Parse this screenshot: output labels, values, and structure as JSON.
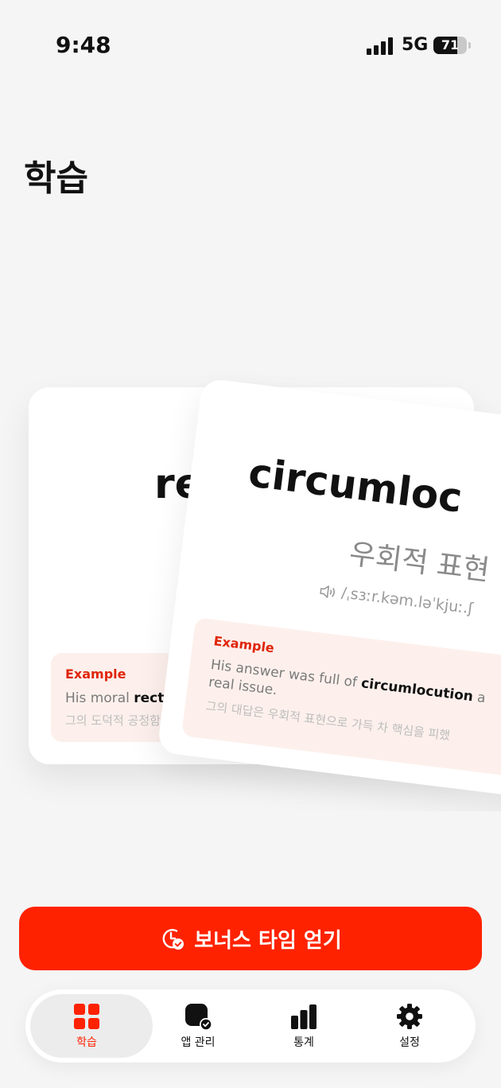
{
  "status_bar": {
    "time": "9:48",
    "network": "5G",
    "battery_percent": 71
  },
  "page": {
    "title": "학습"
  },
  "cards": [
    {
      "word": "rectitude",
      "visible_word": "rect",
      "example": {
        "label": "Example",
        "sentence_before": "His moral ",
        "sentence_highlight": "rectitude",
        "translation": "그의 도덕적 공정함은 으"
      }
    },
    {
      "word": "circumlocution",
      "visible_word": "circumloc",
      "meaning": "우회적 표현",
      "pronunciation": "/ˌsɜːr.kəm.ləˈkjuː.ʃ",
      "example": {
        "label": "Example",
        "sentence_before": "His answer was full of ",
        "sentence_highlight": "circumlocution",
        "sentence_after": " a",
        "sentence_line2": "real issue.",
        "translation": "그의 대답은 우회적 표현으로 가득 차 핵심을 피했"
      }
    }
  ],
  "bonus_button": {
    "label": "보너스 타임 얻기",
    "icon": "timer-check-icon"
  },
  "tab_bar": {
    "tabs": [
      {
        "label": "학습",
        "icon": "grid-icon",
        "active": true
      },
      {
        "label": "앱 관리",
        "icon": "app-check-icon",
        "active": false
      },
      {
        "label": "통계",
        "icon": "bar-chart-icon",
        "active": false
      },
      {
        "label": "설정",
        "icon": "gear-icon",
        "active": false
      }
    ]
  },
  "colors": {
    "accent": "#ff2200",
    "example_bg": "#fdf0ec",
    "example_label": "#e0250a"
  }
}
